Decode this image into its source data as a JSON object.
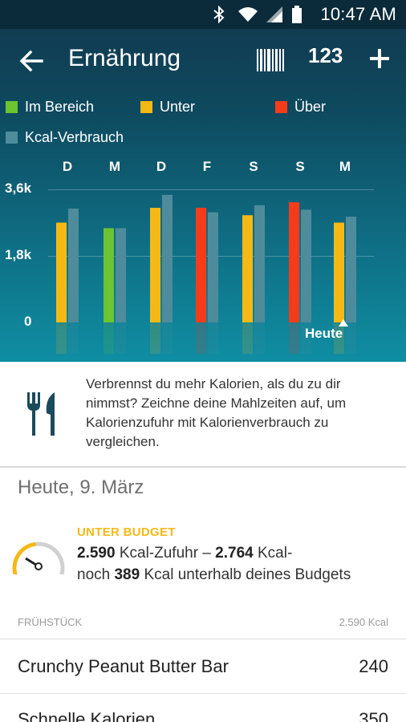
{
  "status_bar": {
    "time": "10:47 AM"
  },
  "header": {
    "title": "Ernährung",
    "entry_button_label": "123"
  },
  "legend": [
    {
      "label": "Im Bereich",
      "color": "#6cc431"
    },
    {
      "label": "Unter",
      "color": "#f5b916"
    },
    {
      "label": "Über",
      "color": "#f63b1a"
    },
    {
      "label": "Kcal-Verbrauch",
      "color": "#4e8c9c"
    }
  ],
  "chart_data": {
    "type": "bar",
    "categories": [
      "D",
      "M",
      "D",
      "F",
      "S",
      "S",
      "M"
    ],
    "y_ticks": [
      "3,6k",
      "1,8k",
      "0"
    ],
    "ylim": [
      0,
      3600
    ],
    "series": [
      {
        "name": "Kcal-Zufuhr",
        "values": [
          2700,
          2550,
          3100,
          3100,
          2900,
          3250,
          2700
        ],
        "colors": [
          "#f5b916",
          "#6cc431",
          "#f5b916",
          "#f63b1a",
          "#f5b916",
          "#f63b1a",
          "#f5b916"
        ]
      },
      {
        "name": "Kcal-Verbrauch",
        "values": [
          3080,
          2550,
          3450,
          2980,
          3170,
          3050,
          2860
        ]
      }
    ],
    "today_label": "Heute"
  },
  "info": {
    "text": "Verbrennst du mehr Kalorien, als du zu dir nimmst? Zeichne deine Mahlzeiten auf, um Kalorienzufuhr mit Kalorienverbrauch zu vergleichen."
  },
  "summary": {
    "date": "Heute, 9. März",
    "status": "UNTER BUDGET",
    "intake_value": "2.590",
    "intake_label": "Kcal-Zufuhr –",
    "burn_value": "2.764",
    "burn_label": "Kcal-",
    "remaining_prefix": "noch",
    "remaining_value": "389",
    "remaining_suffix": "Kcal unterhalb deines Budgets",
    "gauge_level": 0.45
  },
  "meal": {
    "name": "FRÜHSTÜCK",
    "total": "2.590 Kcal"
  },
  "foods": [
    {
      "name": "Crunchy Peanut Butter Bar",
      "calories": "240"
    },
    {
      "name": "Schnelle Kalorien",
      "calories": "350"
    }
  ]
}
